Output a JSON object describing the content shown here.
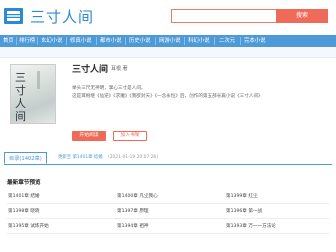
{
  "header": {
    "site_title": "三寸人间",
    "search_placeholder": "",
    "search_button": "搜索"
  },
  "nav": {
    "items": [
      "首页",
      "排行榜",
      "玄幻小说",
      "修真小说",
      "都市小说",
      "历史小说",
      "网游小说",
      "科幻小说",
      "二次元",
      "完本小说"
    ]
  },
  "book": {
    "title": "三寸人间",
    "author": "耳根 著",
    "intro_line_1": "举头三尺无神明，掌心三寸是人间。",
    "intro_line_2": "这是耳根继《仙逆》《求魔》《我欲封天》《一念永恒》后，创作的第五部长篇小说《三寸人间》",
    "read_button": "开始阅读",
    "bookshelf_button": "加入书架"
  },
  "catalog": {
    "tab_label": "目录(1402章)",
    "update_label": "更新至 第1401章 结婚",
    "update_time": "(2021-01-19 20:07:26)"
  },
  "latest": {
    "heading": "最新章节预览",
    "chapters": [
      "第1401章 结婚",
      "第1400章 凡尘我心",
      "第1399章 红尘",
      "第1398章 晓晓",
      "第1397章 原理",
      "第1396章 第一战",
      "第1395章 试炼开始",
      "第1394章 祖神",
      "第1393章 万一一方法论"
    ]
  },
  "colors": {
    "accent_blue": "#4e9ad8",
    "accent_red": "#ef6a59"
  },
  "icons": {
    "logo": "book-stack-icon"
  }
}
